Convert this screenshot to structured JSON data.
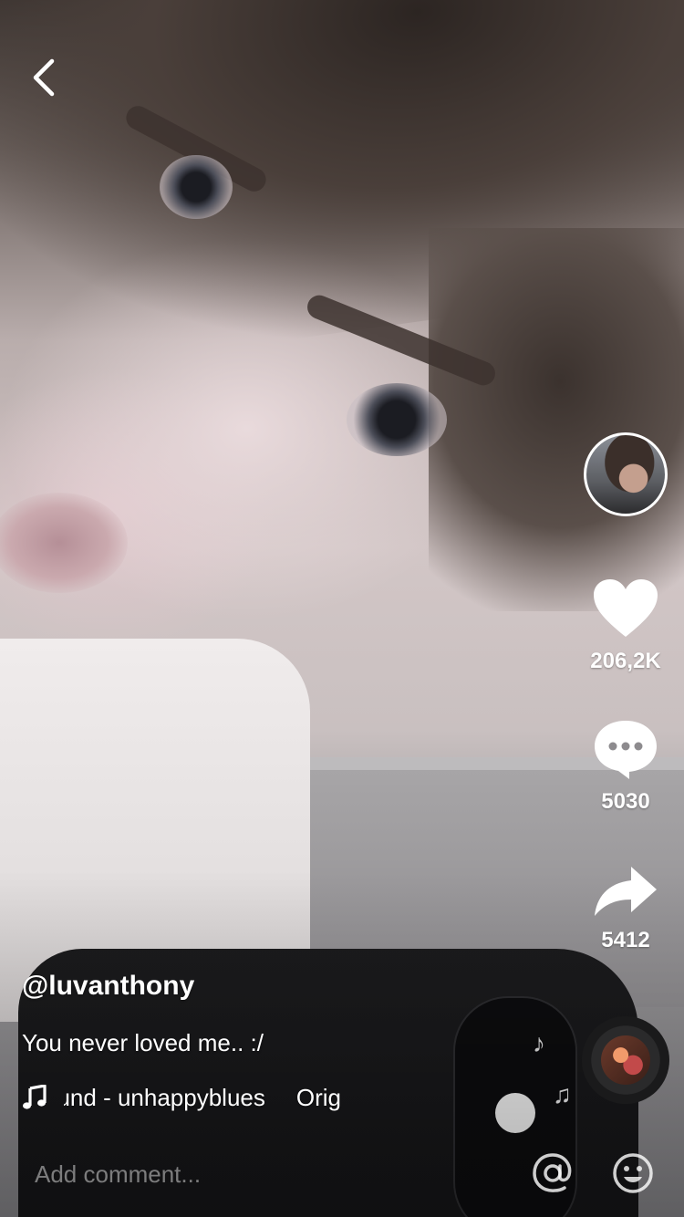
{
  "video": {
    "username": "@luvanthony",
    "description": "You never loved me.. :/",
    "music": {
      "track_visible": "ound - unhappyblues",
      "track_continued": "Orig"
    }
  },
  "actions": {
    "likes": "206,2K",
    "comments": "5030",
    "shares": "5412"
  },
  "comment_bar": {
    "placeholder": "Add comment..."
  },
  "icons": {
    "back": "chevron-left-icon",
    "like": "heart-icon",
    "comment": "speech-bubble-icon",
    "share": "share-arrow-icon",
    "music": "music-note-icon",
    "mention": "at-sign-icon",
    "emoji": "smiley-icon"
  },
  "colors": {
    "icon": "#FFFFFF",
    "overlay_text": "#FFFFFF",
    "placeholder_text": "#FFFFFF73"
  }
}
